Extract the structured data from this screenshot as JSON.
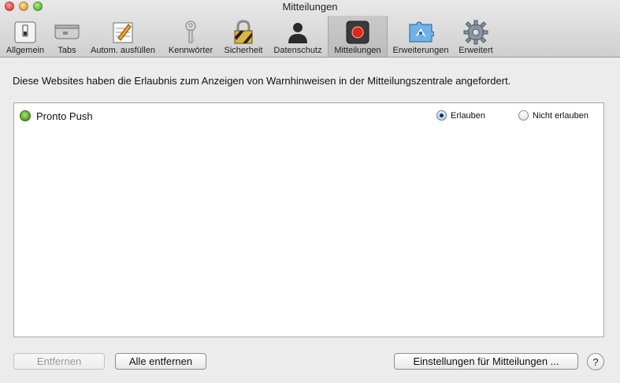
{
  "window": {
    "title": "Mitteilungen"
  },
  "toolbar": {
    "items": [
      {
        "label": "Allgemein",
        "icon": "switch-icon"
      },
      {
        "label": "Tabs",
        "icon": "tabs-icon"
      },
      {
        "label": "Autom. ausfüllen",
        "icon": "pencil-form-icon"
      },
      {
        "label": "Kennwörter",
        "icon": "key-icon"
      },
      {
        "label": "Sicherheit",
        "icon": "lock-icon"
      },
      {
        "label": "Datenschutz",
        "icon": "person-silhouette-icon"
      },
      {
        "label": "Mitteilungen",
        "icon": "notification-dot-icon",
        "selected": true
      },
      {
        "label": "Erweiterungen",
        "icon": "puzzle-compass-icon"
      },
      {
        "label": "Erweitert",
        "icon": "gear-icon"
      }
    ]
  },
  "intro_text": "Diese Websites haben die Erlaubnis zum Anzeigen von Warnhinweisen in der Mitteilungszentrale angefordert.",
  "sites": [
    {
      "name": "Pronto Push",
      "selected_option": "Erlauben",
      "options": [
        "Erlauben",
        "Nicht erlauben"
      ]
    }
  ],
  "buttons": {
    "remove": "Entfernen",
    "remove_all": "Alle entfernen",
    "notification_settings": "Einstellungen für Mitteilungen ...",
    "help": "?"
  },
  "colors": {
    "notification_red": "#e0261b",
    "allow_accent": "#5a7fb8",
    "site_icon_green": "#4c9e1f"
  }
}
